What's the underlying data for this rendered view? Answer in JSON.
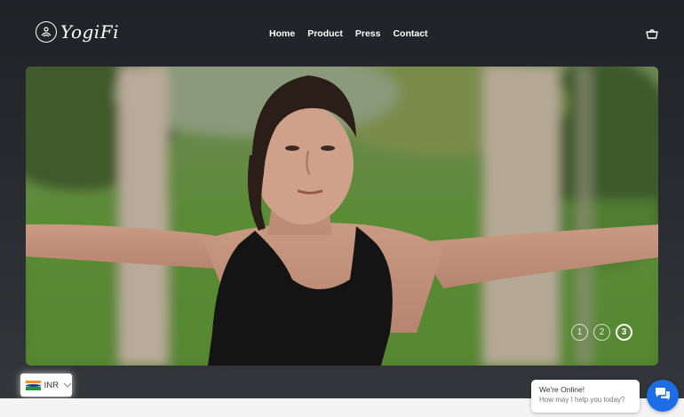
{
  "brand": {
    "name": "YogiFi"
  },
  "nav": {
    "items": [
      "Home",
      "Product",
      "Press",
      "Contact"
    ]
  },
  "hero": {
    "image": "woman-yoga-warrior-pose",
    "slides": [
      "1",
      "2",
      "3"
    ],
    "active_slide": 3
  },
  "currency": {
    "code": "INR",
    "flag": "india-flag-icon"
  },
  "chat": {
    "title": "We're Online!",
    "subtitle": "How may I help you today?",
    "accent": "#1d6de6"
  },
  "colors": {
    "background": "#26292d",
    "footer": "#f4f4f4"
  }
}
